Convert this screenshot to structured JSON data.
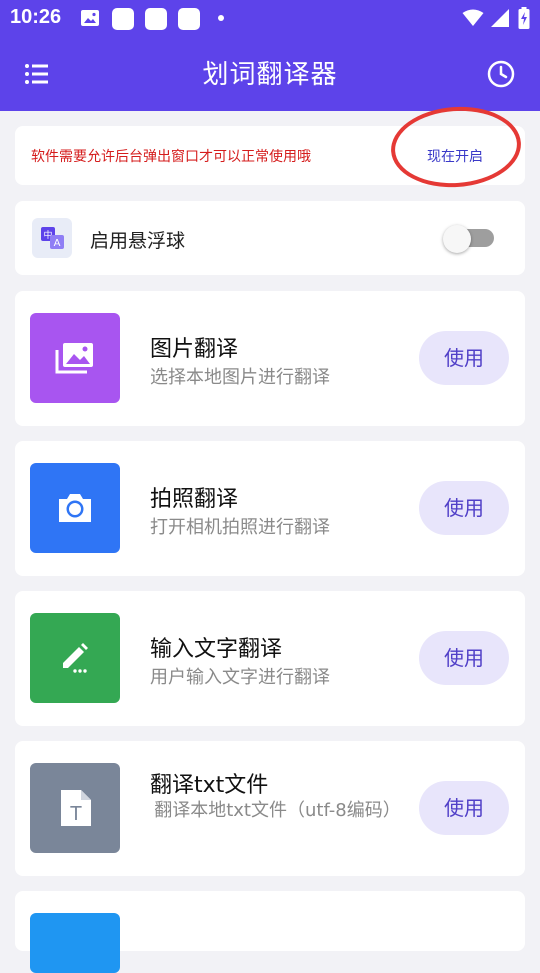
{
  "status_bar": {
    "time": "10:26"
  },
  "app_bar": {
    "title": "划词翻译器",
    "menu_icon": "menu-icon",
    "history_icon": "history-icon"
  },
  "notice": {
    "text": "软件需要允许后台弹出窗口才可以正常使用哦",
    "action": "现在开启",
    "highlight_color": "#e53935"
  },
  "float_ball": {
    "label": "启用悬浮球",
    "enabled": false
  },
  "features": [
    {
      "title": "图片翻译",
      "desc": "选择本地图片进行翻译",
      "button": "使用",
      "icon": "image-icon",
      "color": "#a855f0"
    },
    {
      "title": "拍照翻译",
      "desc": "打开相机拍照进行翻译",
      "button": "使用",
      "icon": "camera-icon",
      "color": "#2f75f5"
    },
    {
      "title": "输入文字翻译",
      "desc": "用户输入文字进行翻译",
      "button": "使用",
      "icon": "edit-icon",
      "color": "#34a853"
    },
    {
      "title": "翻译txt文件",
      "desc": "翻译本地txt文件（utf-8编码）",
      "button": "使用",
      "icon": "text-file-icon",
      "color": "#7a8699"
    }
  ],
  "colors": {
    "primary": "#5d43ea",
    "background": "#f2f2f6"
  }
}
